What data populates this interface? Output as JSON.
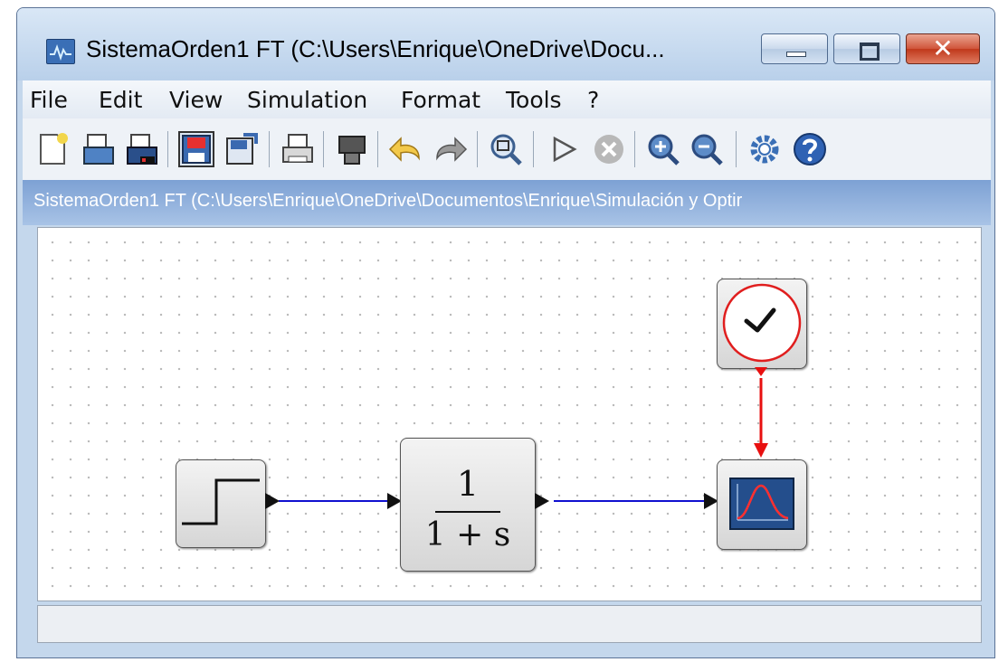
{
  "window": {
    "title": "SistemaOrden1 FT (C:\\Users\\Enrique\\OneDrive\\Docu...",
    "close_glyph": "✕"
  },
  "menu": {
    "items": [
      "File",
      "Edit",
      "View",
      "Simulation",
      "Format",
      "Tools",
      "?"
    ]
  },
  "toolbar": {
    "icons": [
      "new-diagram-icon",
      "open-icon",
      "open-in-scilab-icon",
      "save-icon",
      "save-as-icon",
      "print-icon",
      "export-icon",
      "undo-icon",
      "redo-icon",
      "fit-diagram-icon",
      "start-icon",
      "stop-icon",
      "zoom-in-icon",
      "zoom-out-icon",
      "setup-icon",
      "help-icon"
    ]
  },
  "path_bar": {
    "text": "SistemaOrden1 FT (C:\\Users\\Enrique\\OneDrive\\Documentos\\Enrique\\Simulación y Optir"
  },
  "diagram": {
    "blocks": [
      "step-block",
      "clock-block",
      "transfer-function-block",
      "scope-block"
    ],
    "transfer_function": {
      "numerator": "1",
      "denominator": "1 + s"
    },
    "colors": {
      "regular_link": "#1010d0",
      "activation_link": "#e81010",
      "clock_ring": "#e01e1e",
      "scope_screen": "#244e8c"
    }
  }
}
